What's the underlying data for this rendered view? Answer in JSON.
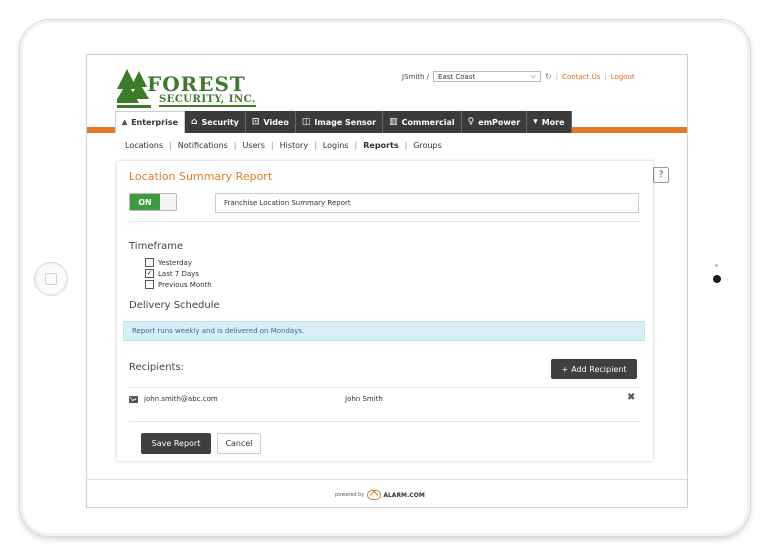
{
  "header": {
    "logo_title": "FOREST",
    "logo_subtitle": "SECURITY, INC.",
    "username": "JSmith /",
    "site": "East Coast",
    "contact_link": "Contact Us",
    "logout_link": "Logout"
  },
  "tabs": [
    {
      "label": "Enterprise",
      "icon": "enterprise-icon",
      "active": true
    },
    {
      "label": "Security",
      "icon": "home-icon"
    },
    {
      "label": "Video",
      "icon": "video-icon"
    },
    {
      "label": "Image Sensor",
      "icon": "image-sensor-icon"
    },
    {
      "label": "Commercial",
      "icon": "commercial-icon"
    },
    {
      "label": "emPower",
      "icon": "lightbulb-icon"
    },
    {
      "label": "More",
      "icon": "caret-down-icon"
    }
  ],
  "subnav": [
    "Locations",
    "Notifications",
    "Users",
    "History",
    "Logins",
    "Reports",
    "Groups"
  ],
  "subnav_current": "Reports",
  "help_label": "?",
  "report": {
    "title": "Location Summary Report",
    "toggle_label": "ON",
    "name_value": "Franchise Location Summary Report",
    "timeframe_title": "Timeframe",
    "timeframe_options": [
      {
        "label": "Yesterday",
        "checked": false
      },
      {
        "label": "Last 7 Days",
        "checked": true
      },
      {
        "label": "Previous Month",
        "checked": false
      }
    ],
    "delivery_title": "Delivery Schedule",
    "delivery_info": "Report runs weekly and is delivered on Mondays.",
    "recipients_title": "Recipients:",
    "add_recipient_label": "Add Recipient",
    "recipients": [
      {
        "email": "john.smith@abc.com",
        "name": "John Smith"
      }
    ],
    "save_label": "Save Report",
    "cancel_label": "Cancel"
  },
  "footer": {
    "powered_by": "powered by",
    "brand": "ALARM.COM"
  },
  "colors": {
    "accent": "#e37a24",
    "brand_green": "#3d7a2a",
    "nav_dark": "#3b3b3b"
  }
}
